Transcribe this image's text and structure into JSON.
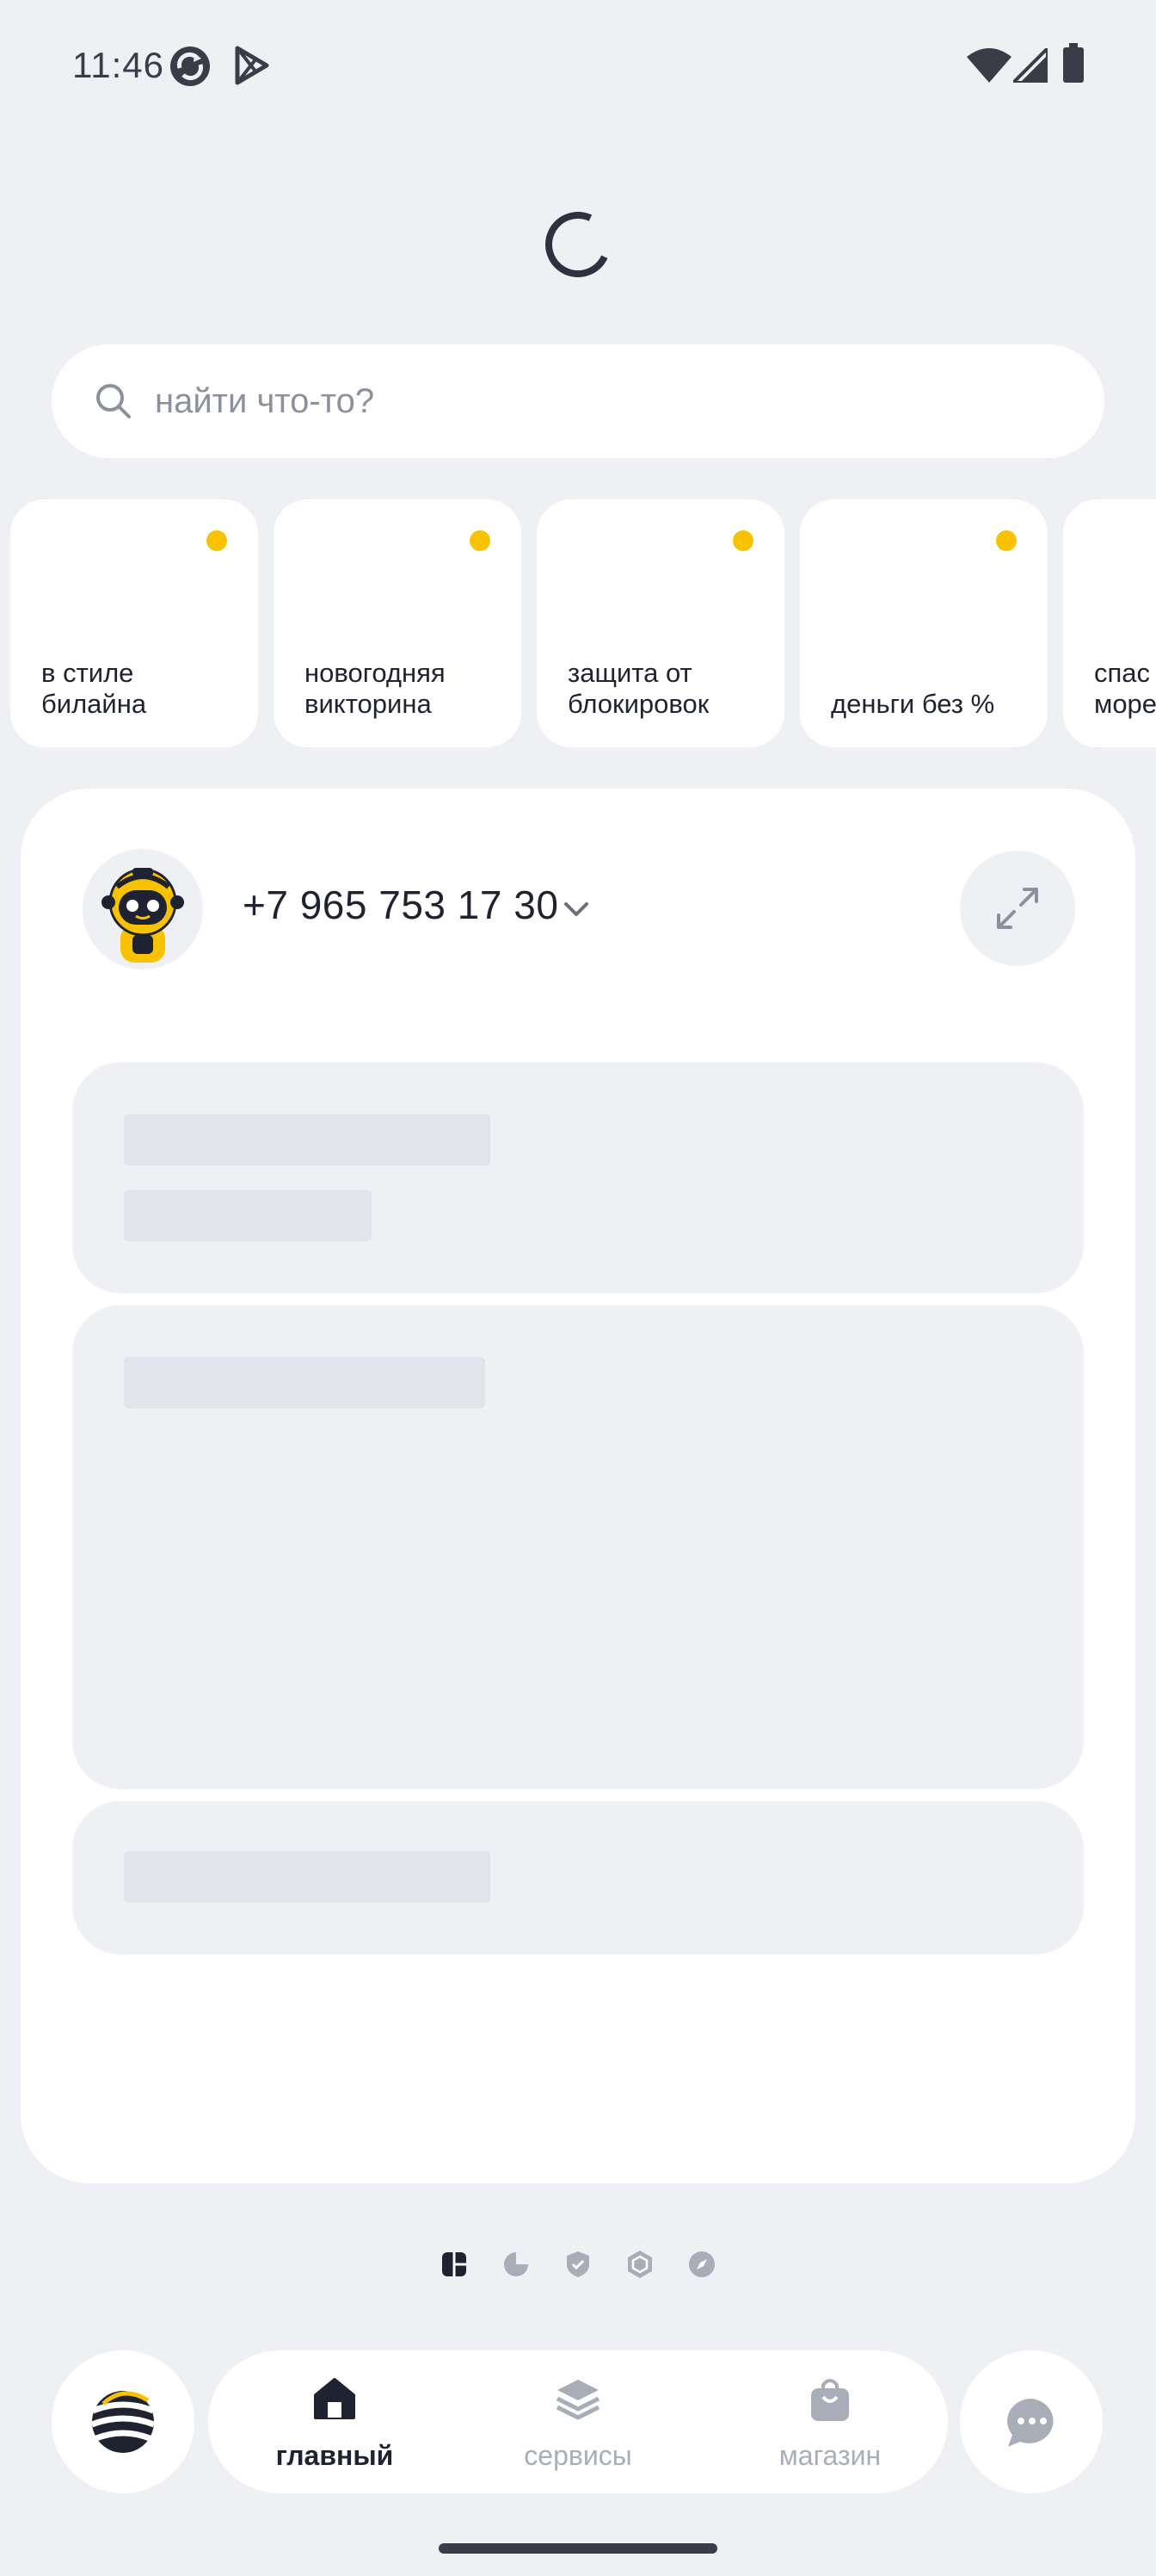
{
  "status_bar": {
    "time": "11:46",
    "icons": [
      "sync-app-icon",
      "play-store-icon",
      "wifi-icon",
      "cellular-signal-icon",
      "battery-icon"
    ]
  },
  "loading": {
    "icon": "loading-spinner-icon"
  },
  "search": {
    "placeholder": "найти что-то?",
    "value": "",
    "icon": "search-icon"
  },
  "stories": [
    {
      "title": "в стиле\nбилайна",
      "unread": true
    },
    {
      "title": "новогодняя\nвикторина",
      "unread": true
    },
    {
      "title": "защита от\nблокировок",
      "unread": true
    },
    {
      "title": "деньги без %",
      "unread": true
    },
    {
      "title": "спас\nморе",
      "unread": false
    }
  ],
  "account": {
    "phone": "+7 965 753 17 30",
    "avatar_icon": "robot-avatar-icon",
    "dropdown_icon": "chevron-down-icon",
    "expand_icon": "expand-arrows-icon"
  },
  "page_indicator": {
    "pages": [
      "dashboard-icon",
      "pie-chart-icon",
      "shield-check-icon",
      "hexagon-icon",
      "compass-icon"
    ],
    "active_index": 0
  },
  "bottom_nav": {
    "left_button_icon": "beeline-logo-icon",
    "items": [
      {
        "label": "главный",
        "icon": "home-icon",
        "active": true
      },
      {
        "label": "сервисы",
        "icon": "layers-icon",
        "active": false
      },
      {
        "label": "магазин",
        "icon": "shopping-bag-icon",
        "active": false
      }
    ],
    "right_button_icon": "chat-icon"
  },
  "colors": {
    "background": "#eef0f3",
    "surface": "#ffffff",
    "accent_yellow": "#f9c200",
    "text_primary": "#1f2230",
    "text_muted": "#8c909c",
    "skeleton": "#e1e4ea"
  }
}
